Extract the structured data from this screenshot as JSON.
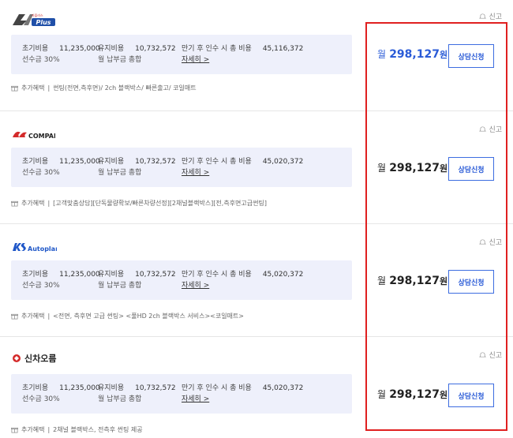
{
  "cards": [
    {
      "logo_text": "Plus",
      "logo_small": "카플러스",
      "report": "신고",
      "initial_cost_label": "초기비용",
      "initial_cost_value": "11,235,000",
      "advance_label": "선수금 30%",
      "maintain_label": "유지비용",
      "maintain_value": "10,732,572",
      "monthly_total_label": "월 납부금 총합",
      "expire_label": "만기 후 인수 시 총 비용",
      "expire_value": "45,116,372",
      "detail_link": "자세히 >",
      "benefit_label": "추가혜택",
      "benefit_text": "썬팅(전면,측후면)/ 2ch 블랙박스/ 빠른출고/ 코일매트",
      "price_prefix": "월",
      "price_value": "298,127",
      "price_suffix": "원",
      "cta": "상담신청"
    },
    {
      "logo_text": "COMPANY",
      "logo_small": "",
      "report": "신고",
      "initial_cost_label": "초기비용",
      "initial_cost_value": "11,235,000",
      "advance_label": "선수금 30%",
      "maintain_label": "유지비용",
      "maintain_value": "10,732,572",
      "monthly_total_label": "월 납부금 총합",
      "expire_label": "만기 후 인수 시 총 비용",
      "expire_value": "45,020,372",
      "detail_link": "자세히 >",
      "benefit_label": "추가혜택",
      "benefit_text": "[고객맞춤상담][단독물량확보/빠른차량선정][2채널블랙박스][전,측후면고급썬팅]",
      "price_prefix": "월",
      "price_value": "298,127",
      "price_suffix": "원",
      "cta": "상담신청"
    },
    {
      "logo_text": "Autoplan",
      "logo_small": "",
      "report": "신고",
      "initial_cost_label": "초기비용",
      "initial_cost_value": "11,235,000",
      "advance_label": "선수금 30%",
      "maintain_label": "유지비용",
      "maintain_value": "10,732,572",
      "monthly_total_label": "월 납부금 총합",
      "expire_label": "만기 후 인수 시 총 비용",
      "expire_value": "45,020,372",
      "detail_link": "자세히 >",
      "benefit_label": "추가혜택",
      "benefit_text": "<전면, 측후면 고급 썬팅> <풀HD 2ch 블랙박스 서비스><코일매트>",
      "price_prefix": "월",
      "price_value": "298,127",
      "price_suffix": "원",
      "cta": "상담신청"
    },
    {
      "logo_text": "신차오름",
      "logo_small": "",
      "report": "신고",
      "initial_cost_label": "초기비용",
      "initial_cost_value": "11,235,000",
      "advance_label": "선수금 30%",
      "maintain_label": "유지비용",
      "maintain_value": "10,732,572",
      "monthly_total_label": "월 납부금 총합",
      "expire_label": "만기 후 인수 시 총 비용",
      "expire_value": "45,020,372",
      "detail_link": "자세히 >",
      "benefit_label": "추가혜택",
      "benefit_text": "2채널 블랙박스, 전측후 썬팅 제공",
      "price_prefix": "월",
      "price_value": "298,127",
      "price_suffix": "원",
      "cta": "상담신청"
    }
  ],
  "colors": {
    "accent": "#2a5bd7",
    "highlight_frame": "#e02020",
    "info_bg": "#eef0fb"
  }
}
